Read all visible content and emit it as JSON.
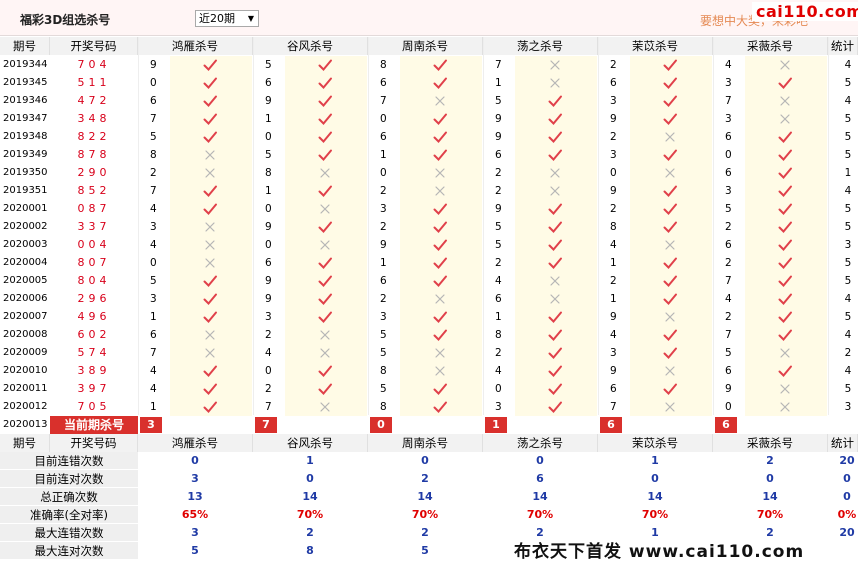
{
  "title": "福彩3D组选杀号",
  "period_select": "近20期",
  "promo": "要想中大奖，来彩吧",
  "logo": "cai110.com",
  "watermark": "布衣天下首发 www.cai110.com",
  "headers": {
    "period": "期号",
    "draw": "开奖号码",
    "total": "统计"
  },
  "experts": [
    "鸿雁杀号",
    "谷风杀号",
    "周南杀号",
    "荡之杀号",
    "茉苡杀号",
    "采薇杀号"
  ],
  "rows": [
    {
      "period": "2019344",
      "draw": "704",
      "kills": [
        9,
        5,
        8,
        7,
        2,
        4
      ],
      "hits": [
        1,
        1,
        1,
        0,
        1,
        0
      ],
      "total": 4
    },
    {
      "period": "2019345",
      "draw": "511",
      "kills": [
        0,
        6,
        6,
        1,
        6,
        3
      ],
      "hits": [
        1,
        1,
        1,
        0,
        1,
        1
      ],
      "total": 5
    },
    {
      "period": "2019346",
      "draw": "472",
      "kills": [
        6,
        9,
        7,
        5,
        3,
        7
      ],
      "hits": [
        1,
        1,
        0,
        1,
        1,
        0
      ],
      "total": 4
    },
    {
      "period": "2019347",
      "draw": "348",
      "kills": [
        7,
        1,
        0,
        9,
        9,
        3
      ],
      "hits": [
        1,
        1,
        1,
        1,
        1,
        0
      ],
      "total": 5
    },
    {
      "period": "2019348",
      "draw": "822",
      "kills": [
        5,
        0,
        6,
        9,
        2,
        6
      ],
      "hits": [
        1,
        1,
        1,
        1,
        0,
        1
      ],
      "total": 5
    },
    {
      "period": "2019349",
      "draw": "878",
      "kills": [
        8,
        5,
        1,
        6,
        3,
        0
      ],
      "hits": [
        0,
        1,
        1,
        1,
        1,
        1
      ],
      "total": 5
    },
    {
      "period": "2019350",
      "draw": "290",
      "kills": [
        2,
        8,
        0,
        2,
        0,
        6
      ],
      "hits": [
        0,
        0,
        0,
        0,
        0,
        1
      ],
      "total": 1
    },
    {
      "period": "2019351",
      "draw": "852",
      "kills": [
        7,
        1,
        2,
        2,
        9,
        3
      ],
      "hits": [
        1,
        1,
        0,
        0,
        1,
        1
      ],
      "total": 4
    },
    {
      "period": "2020001",
      "draw": "087",
      "kills": [
        4,
        0,
        3,
        9,
        2,
        5
      ],
      "hits": [
        1,
        0,
        1,
        1,
        1,
        1
      ],
      "total": 5
    },
    {
      "period": "2020002",
      "draw": "337",
      "kills": [
        3,
        9,
        2,
        5,
        8,
        2
      ],
      "hits": [
        0,
        1,
        1,
        1,
        1,
        1
      ],
      "total": 5
    },
    {
      "period": "2020003",
      "draw": "004",
      "kills": [
        4,
        0,
        9,
        5,
        4,
        6
      ],
      "hits": [
        0,
        0,
        1,
        1,
        0,
        1
      ],
      "total": 3
    },
    {
      "period": "2020004",
      "draw": "807",
      "kills": [
        0,
        6,
        1,
        2,
        1,
        2
      ],
      "hits": [
        0,
        1,
        1,
        1,
        1,
        1
      ],
      "total": 5
    },
    {
      "period": "2020005",
      "draw": "804",
      "kills": [
        5,
        9,
        6,
        4,
        2,
        7
      ],
      "hits": [
        1,
        1,
        1,
        0,
        1,
        1
      ],
      "total": 5
    },
    {
      "period": "2020006",
      "draw": "296",
      "kills": [
        3,
        9,
        2,
        6,
        1,
        4
      ],
      "hits": [
        1,
        1,
        0,
        0,
        1,
        1
      ],
      "total": 4
    },
    {
      "period": "2020007",
      "draw": "496",
      "kills": [
        1,
        3,
        3,
        1,
        9,
        2
      ],
      "hits": [
        1,
        1,
        1,
        1,
        0,
        1
      ],
      "total": 5
    },
    {
      "period": "2020008",
      "draw": "602",
      "kills": [
        6,
        2,
        5,
        8,
        4,
        7
      ],
      "hits": [
        0,
        0,
        1,
        1,
        1,
        1
      ],
      "total": 4
    },
    {
      "period": "2020009",
      "draw": "574",
      "kills": [
        7,
        4,
        5,
        2,
        3,
        5
      ],
      "hits": [
        0,
        0,
        0,
        1,
        1,
        0
      ],
      "total": 2
    },
    {
      "period": "2020010",
      "draw": "389",
      "kills": [
        4,
        0,
        8,
        4,
        9,
        6
      ],
      "hits": [
        1,
        1,
        0,
        1,
        0,
        1
      ],
      "total": 4
    },
    {
      "period": "2020011",
      "draw": "397",
      "kills": [
        4,
        2,
        5,
        0,
        6,
        9
      ],
      "hits": [
        1,
        1,
        1,
        1,
        1,
        0
      ],
      "total": 5
    },
    {
      "period": "2020012",
      "draw": "705",
      "kills": [
        1,
        7,
        8,
        3,
        7,
        0
      ],
      "hits": [
        1,
        0,
        1,
        1,
        0,
        0
      ],
      "total": 3
    }
  ],
  "current": {
    "period": "2020013",
    "label": "当前期杀号",
    "kills": [
      3,
      7,
      0,
      1,
      6,
      6
    ]
  },
  "stats": [
    {
      "label": "目前连错次数",
      "values": [
        "0",
        "1",
        "0",
        "0",
        "1",
        "2"
      ],
      "total": "20"
    },
    {
      "label": "目前连对次数",
      "values": [
        "3",
        "0",
        "2",
        "6",
        "0",
        "0"
      ],
      "total": "0"
    },
    {
      "label": "总正确次数",
      "values": [
        "13",
        "14",
        "14",
        "14",
        "14",
        "14"
      ],
      "total": "0"
    },
    {
      "label": "准确率(全对率)",
      "values": [
        "65%",
        "70%",
        "70%",
        "70%",
        "70%",
        "70%"
      ],
      "total": "0%",
      "red": true
    },
    {
      "label": "最大连错次数",
      "values": [
        "3",
        "2",
        "2",
        "2",
        "1",
        "2"
      ],
      "total": "20"
    },
    {
      "label": "最大连对次数",
      "values": [
        "5",
        "8",
        "5",
        "",
        "",
        ""
      ],
      "total": ""
    }
  ],
  "colors": {
    "accent": "#d9302c",
    "check": "#e0404a",
    "cross": "#b5b5b5",
    "shade": "#fffbe6",
    "stat_blue": "#1f3aa5"
  }
}
